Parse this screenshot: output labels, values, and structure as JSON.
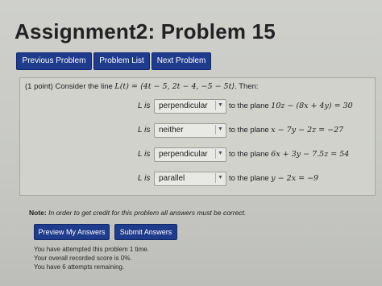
{
  "title": "Assignment2: Problem 15",
  "nav": {
    "previous": "Previous Problem",
    "list": "Problem List",
    "next": "Next Problem"
  },
  "problem": {
    "intro_prefix": "(1 point) Consider the line ",
    "intro_math": "L(t) = ⟨4t − 5, 2t − 4, −5 − 5t⟩",
    "intro_suffix": ". Then:",
    "rows": [
      {
        "lis": "L is",
        "answer": "perpendicular",
        "plane_prefix": "to the plane ",
        "plane_math": "10z − (8x + 4y) = 30"
      },
      {
        "lis": "L is",
        "answer": "neither",
        "plane_prefix": "to the plane ",
        "plane_math": "x − 7y − 2z = −27"
      },
      {
        "lis": "L is",
        "answer": "perpendicular",
        "plane_prefix": "to the plane ",
        "plane_math": "6x + 3y − 7.5z = 54"
      },
      {
        "lis": "L is",
        "answer": "parallel",
        "plane_prefix": "to the plane ",
        "plane_math": "y − 2x = −9"
      }
    ]
  },
  "note": {
    "label": "Note:",
    "text": " In order to get credit for this problem all answers must be correct."
  },
  "actions": {
    "preview": "Preview My Answers",
    "submit": "Submit Answers"
  },
  "status": {
    "attempted": "You have attempted this problem 1 time.",
    "score": "Your overall recorded score is 0%.",
    "remaining": "You have 6 attempts remaining."
  },
  "colors": {
    "button_blue": "#1f3b8c",
    "background": "#cfd0cc"
  }
}
